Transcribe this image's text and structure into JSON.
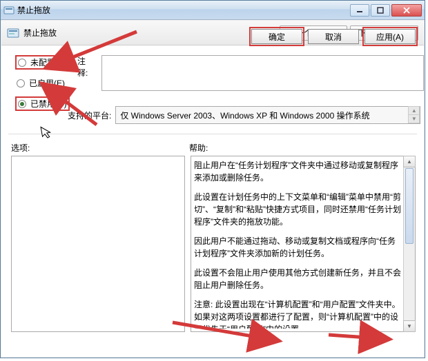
{
  "window": {
    "title": "禁止拖放",
    "subtitle": "禁止拖放"
  },
  "nav": {
    "prev": "上一个设置(P)",
    "next": "下一个设置(N)"
  },
  "radios": {
    "not_configured": "未配置(C)",
    "enabled": "已启用(E)",
    "disabled": "已禁用(D)"
  },
  "labels": {
    "note": "注释:",
    "platform": "支持的平台:",
    "options": "选项:",
    "help": "帮助:"
  },
  "platform_text": "仅 Windows Server 2003、Windows XP 和 Windows 2000 操作系统",
  "help_paragraphs": [
    "阻止用户在“任务计划程序”文件夹中通过移动或复制程序来添加或删除任务。",
    "此设置在计划任务中的上下文菜单和“编辑”菜单中禁用“剪切”、“复制”和“粘贴”快捷方式项目，同时还禁用“任务计划程序”文件夹的拖放功能。",
    "因此用户不能通过拖动、移动或复制文档或程序向“任务计划程序”文件夹添加新的计划任务。",
    "此设置不会阻止用户使用其他方式创建新任务，并且不会阻止用户删除任务。",
    "注意: 此设置出现在“计算机配置”和“用户配置”文件夹中。如果对这两项设置都进行了配置，则“计算机配置”中的设置优先于“用户配置”中的设置。"
  ],
  "buttons": {
    "ok": "确定",
    "cancel": "取消",
    "apply": "应用(A)"
  }
}
